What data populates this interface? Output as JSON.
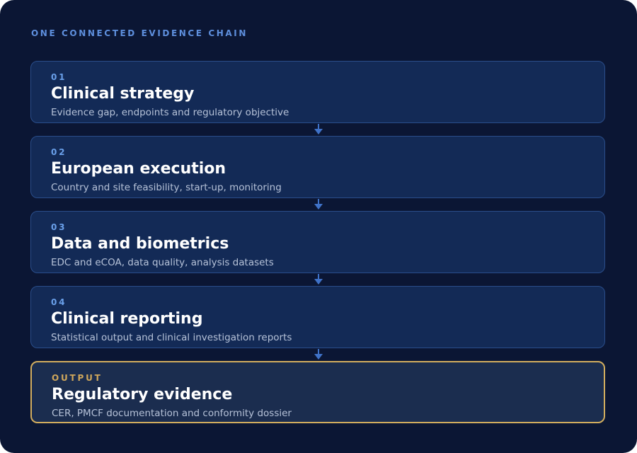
{
  "header": {
    "eyebrow": "ONE CONNECTED EVIDENCE CHAIN"
  },
  "steps": [
    {
      "number": "01",
      "title": "Clinical strategy",
      "description": "Evidence gap, endpoints and regulatory objective"
    },
    {
      "number": "02",
      "title": "European execution",
      "description": "Country and site feasibility, start-up, monitoring"
    },
    {
      "number": "03",
      "title": "Data and biometrics",
      "description": "EDC and eCOA, data quality, analysis datasets"
    },
    {
      "number": "04",
      "title": "Clinical reporting",
      "description": "Statistical output and clinical investigation reports"
    }
  ],
  "output": {
    "label": "OUTPUT",
    "title": "Regulatory evidence",
    "description": "CER, PMCF documentation and conformity dossier"
  },
  "colors": {
    "background": "#0b1634",
    "card": "#132a56",
    "card_border": "#2a4d8a",
    "accent_blue": "#6aa0ea",
    "accent_gold": "#d2ad5e",
    "arrow": "#3f72c8"
  },
  "icons": {
    "connector": "arrow-down-icon"
  }
}
